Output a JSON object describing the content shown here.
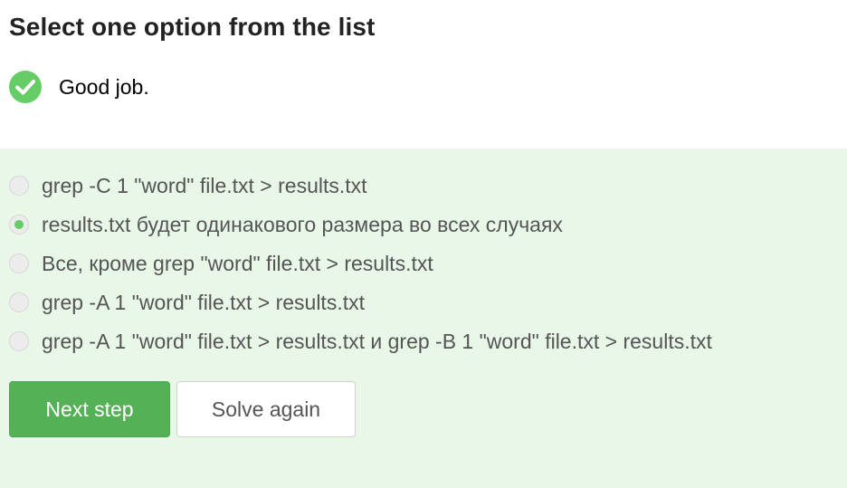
{
  "header": {
    "title": "Select one option from the list"
  },
  "feedback": {
    "icon": "check-circle-icon",
    "text": "Good job.",
    "color": "#66cc66"
  },
  "options": [
    {
      "label": "grep -C 1 \"word\" file.txt > results.txt",
      "selected": false
    },
    {
      "label": "results.txt будет одинакового размера во всех случаях",
      "selected": true
    },
    {
      "label": "Все, кроме grep \"word\" file.txt > results.txt",
      "selected": false
    },
    {
      "label": "grep -A 1 \"word\" file.txt > results.txt",
      "selected": false
    },
    {
      "label": "grep -A 1 \"word\" file.txt > results.txt и grep -B 1 \"word\" file.txt > results.txt",
      "selected": false
    }
  ],
  "actions": {
    "next_label": "Next step",
    "solve_again_label": "Solve again"
  },
  "colors": {
    "quiz_background": "#e8f7e8",
    "primary_button": "#55b155",
    "selected_radio": "#66cc66"
  }
}
